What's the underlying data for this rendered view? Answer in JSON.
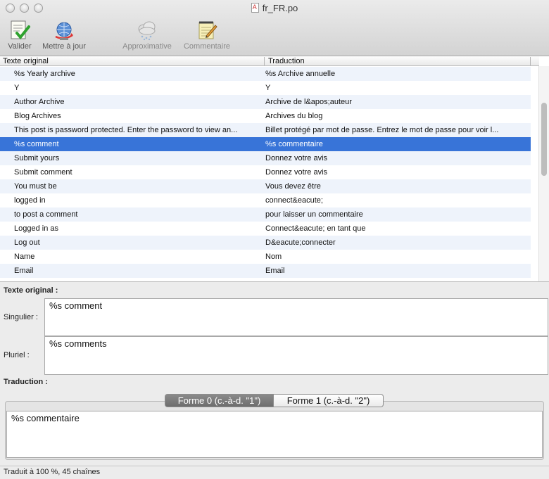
{
  "window": {
    "title": "fr_FR.po"
  },
  "toolbar": {
    "validate_label": "Valider",
    "update_label": "Mettre à jour",
    "fuzzy_label": "Approximative",
    "comment_label": "Commentaire"
  },
  "table": {
    "headers": {
      "source": "Texte original",
      "translation": "Traduction"
    },
    "rows": [
      {
        "source": "%s Yearly archive",
        "translation": "%s Archive annuelle"
      },
      {
        "source": "Y",
        "translation": "Y"
      },
      {
        "source": "Author Archive",
        "translation": "Archive de l&apos;auteur"
      },
      {
        "source": "Blog Archives",
        "translation": "Archives du blog"
      },
      {
        "source": "This post is password protected. Enter the password to view an...",
        "translation": "Billet protégé par mot de passe. Entrez le mot de passe pour voir l..."
      },
      {
        "source": "%s comment",
        "translation": "%s commentaire"
      },
      {
        "source": "Submit yours",
        "translation": "Donnez votre avis"
      },
      {
        "source": "Submit comment",
        "translation": "Donnez votre avis"
      },
      {
        "source": "You must be",
        "translation": "Vous devez être"
      },
      {
        "source": "logged in",
        "translation": "connect&eacute;"
      },
      {
        "source": "to post a comment",
        "translation": "pour laisser un commentaire"
      },
      {
        "source": "Logged in as",
        "translation": "Connect&eacute; en tant que"
      },
      {
        "source": "Log out",
        "translation": "D&eacute;connecter"
      },
      {
        "source": "Name",
        "translation": "Nom"
      },
      {
        "source": "Email",
        "translation": "Email"
      }
    ],
    "selected_index": 5
  },
  "editor": {
    "original_heading": "Texte original :",
    "singular_label": "Singulier :",
    "singular_value": "%s comment",
    "plural_label": "Pluriel :",
    "plural_value": "%s comments",
    "translation_heading": "Traduction :",
    "tabs": [
      {
        "label": "Forme 0 (c.-à-d. \"1\")"
      },
      {
        "label": "Forme 1 (c.-à-d. \"2\")"
      }
    ],
    "translation_value": "%s commentaire"
  },
  "status": {
    "text": "Traduit à 100 %, 45 chaînes"
  },
  "colors": {
    "selection": "#3874d8",
    "row_alt": "#eef3fb"
  }
}
